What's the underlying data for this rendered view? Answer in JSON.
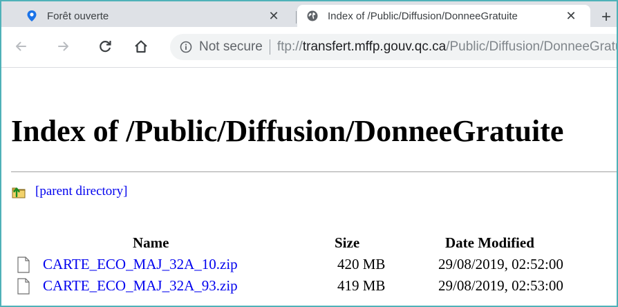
{
  "tabs": [
    {
      "title": "Forêt ouverte",
      "favicon": "map-pin-icon",
      "active": false,
      "close": "✕"
    },
    {
      "title": "Index of /Public/Diffusion/DonneeGratuite",
      "favicon": "globe-icon",
      "active": true,
      "close": "✕"
    }
  ],
  "new_tab": "+",
  "toolbar": {
    "security_text": "Not secure",
    "url_scheme": "ftp://",
    "url_host": "transfert.mffp.gouv.qc.ca",
    "url_path": "/Public/Diffusion/DonneeGratuite"
  },
  "page": {
    "title": "Index of /Public/Diffusion/DonneeGratuite",
    "parent_link": "[parent directory]",
    "columns": {
      "name": "Name",
      "size": "Size",
      "date": "Date Modified"
    },
    "files": [
      {
        "name": "CARTE_ECO_MAJ_32A_10.zip",
        "size": "420 MB",
        "date": "29/08/2019, 02:52:00"
      },
      {
        "name": "CARTE_ECO_MAJ_32A_93.zip",
        "size": "419 MB",
        "date": "29/08/2019, 02:53:00"
      }
    ]
  },
  "colors": {
    "link": "#0000ee",
    "frame": "#4fb1b8",
    "tabstrip": "#dee1e6",
    "favicon_blue": "#1a73e8"
  }
}
